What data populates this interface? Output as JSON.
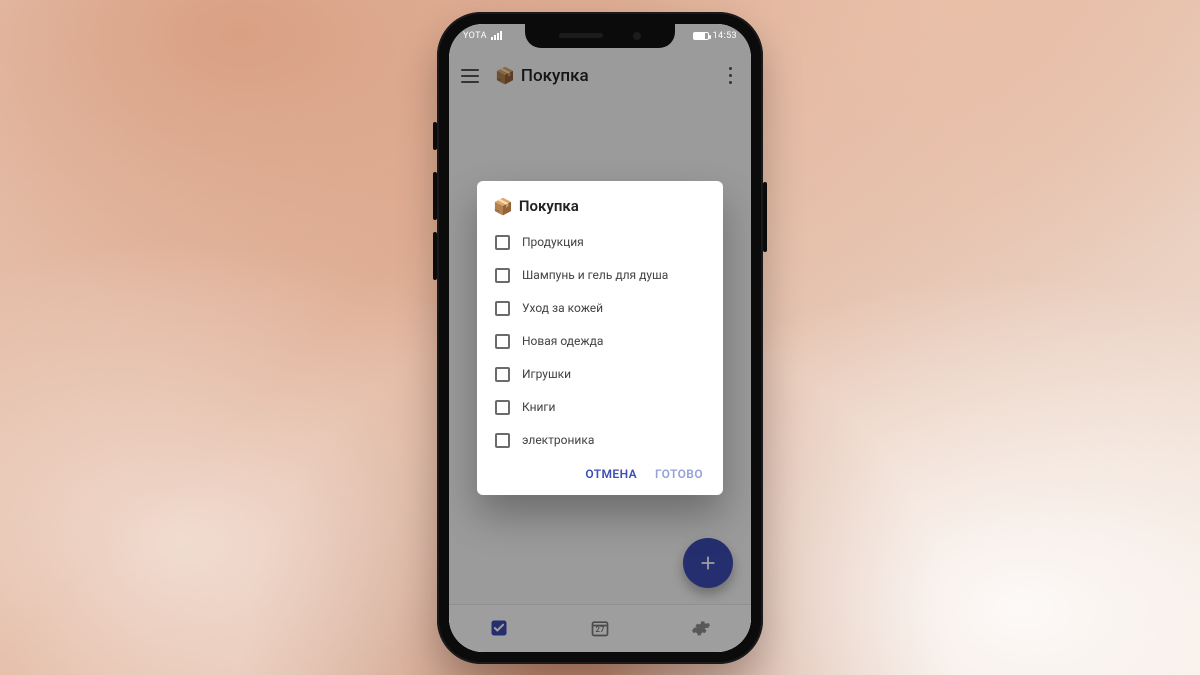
{
  "statusbar": {
    "carrier": "YOTA",
    "time": "14:53"
  },
  "appbar": {
    "icon": "📦",
    "title": "Покупка"
  },
  "navbar": {
    "calendar_day": "27"
  },
  "dialog": {
    "icon": "📦",
    "title": "Покупка",
    "items": [
      {
        "label": "Продукция",
        "checked": false
      },
      {
        "label": "Шампунь и гель для душа",
        "checked": false
      },
      {
        "label": "Уход за кожей",
        "checked": false
      },
      {
        "label": "Новая одежда",
        "checked": false
      },
      {
        "label": "Игрушки",
        "checked": false
      },
      {
        "label": "Книги",
        "checked": false
      },
      {
        "label": "электроника",
        "checked": false
      }
    ],
    "cancel_label": "ОТМЕНА",
    "confirm_label": "ГОТОВО"
  }
}
